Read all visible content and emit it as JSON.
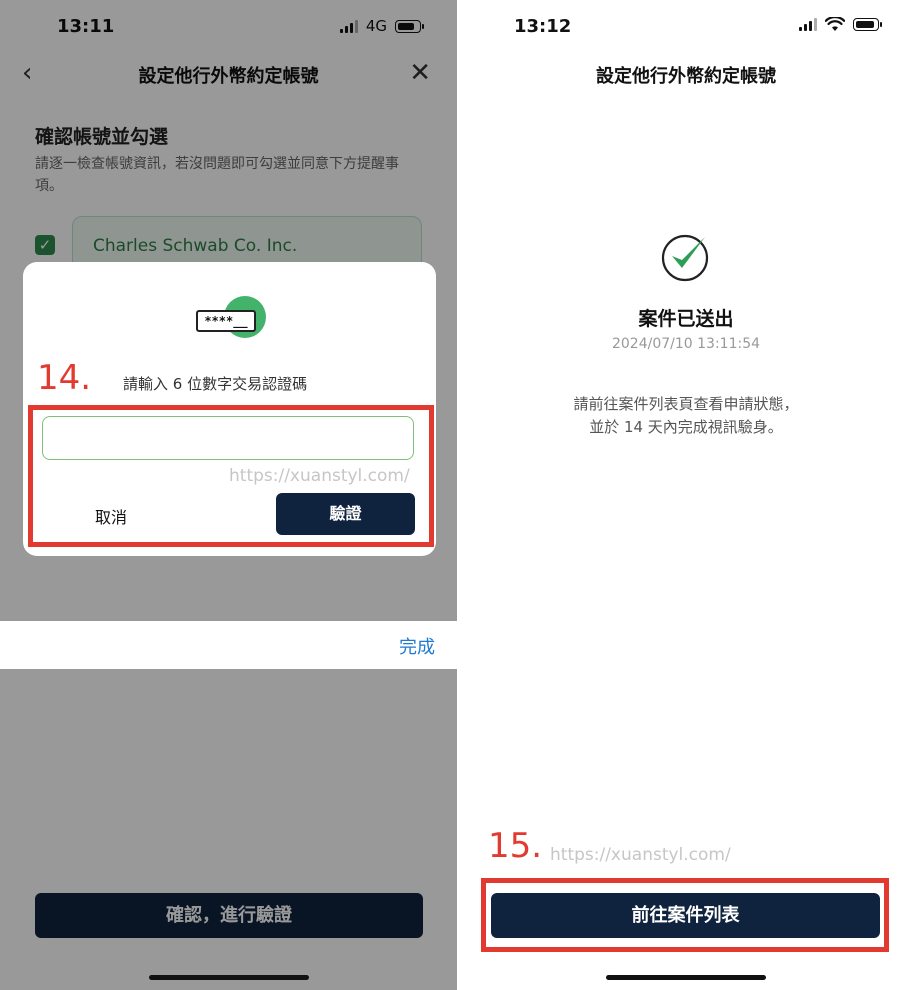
{
  "left_screen": {
    "status": {
      "time": "13:11",
      "network": "4G"
    },
    "nav": {
      "title": "設定他行外幣約定帳號"
    },
    "section": {
      "title": "確認帳號並勾選",
      "desc": "請逐一檢查帳號資訊，若沒問題即可勾選並同意下方提醒事項。"
    },
    "account": {
      "name": "Charles Schwab Co. Inc.",
      "checked": true
    },
    "dialog": {
      "card_mask": "****__",
      "prompt": "請輸入 6 位數字交易認證碼",
      "input_value": "",
      "cancel_label": "取消",
      "verify_label": "驗證",
      "watermark": "https://xuanstyl.com/",
      "step_label": "14."
    },
    "keyboard_bar": {
      "done_label": "完成"
    },
    "bottom_button": "確認，進行驗證"
  },
  "right_screen": {
    "status": {
      "time": "13:12"
    },
    "nav": {
      "title": "設定他行外幣約定帳號"
    },
    "success": {
      "title": "案件已送出",
      "timestamp": "2024/07/10 13:11:54",
      "message_line1": "請前往案件列表頁查看申請狀態，",
      "message_line2": "並於 14 天內完成視訊驗身。"
    },
    "step_label": "15.",
    "watermark": "https://xuanstyl.com/",
    "primary_button": "前往案件列表"
  },
  "colors": {
    "primary": "#0f233f",
    "success_green": "#2e9e55",
    "annotation_red": "#e23a30",
    "link_blue": "#1f7ad1"
  }
}
